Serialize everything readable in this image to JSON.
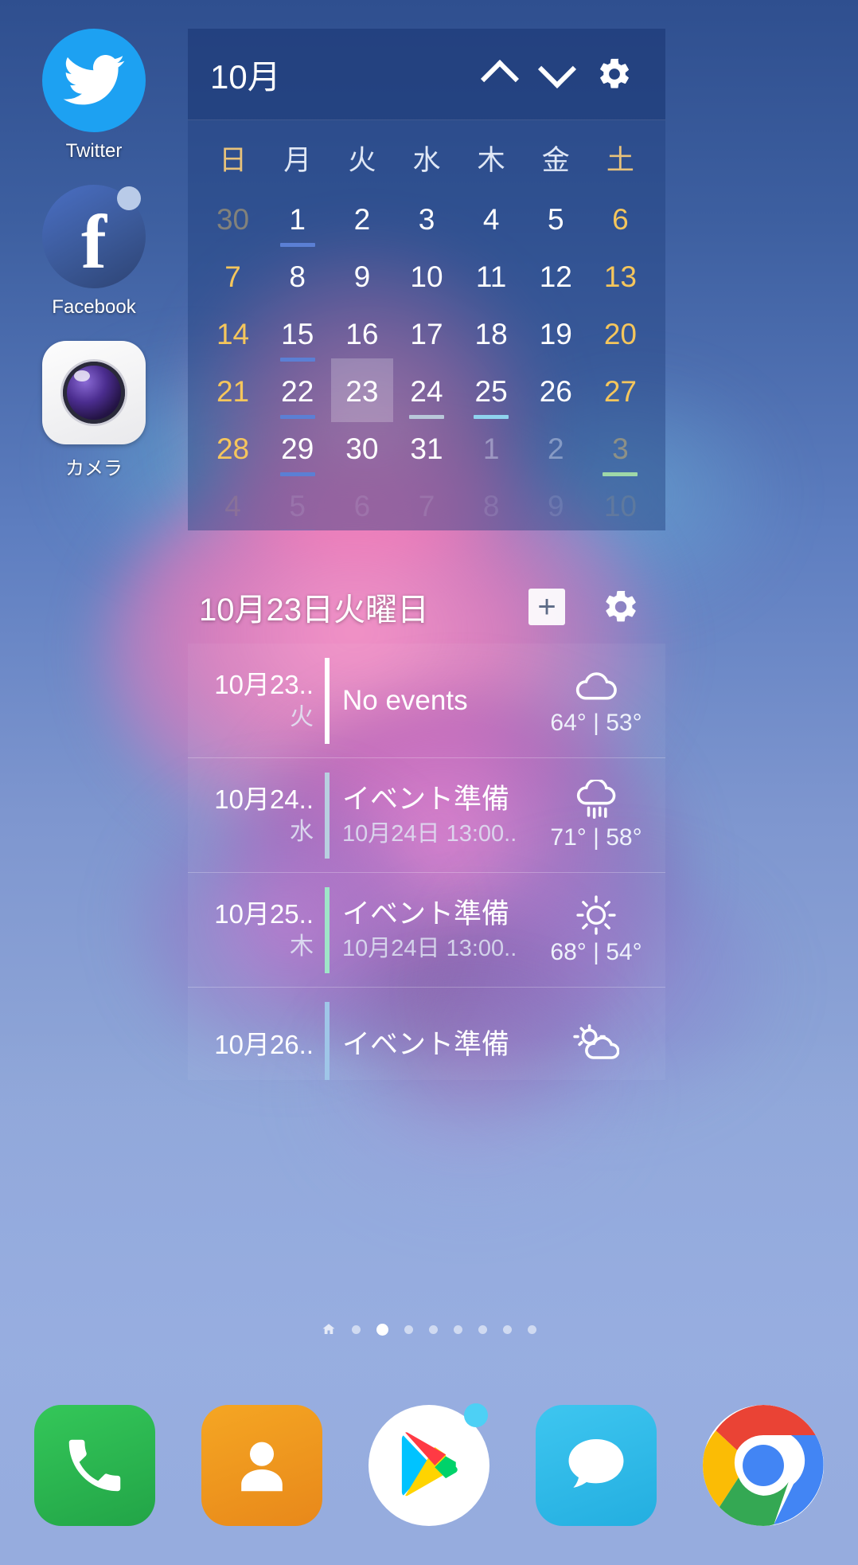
{
  "apps": [
    {
      "label": "Twitter",
      "icon": "twitter-icon",
      "badge": false
    },
    {
      "label": "Facebook",
      "icon": "facebook-icon",
      "badge": true
    },
    {
      "label": "カメラ",
      "icon": "camera-icon",
      "badge": false
    }
  ],
  "calendar_widget": {
    "month_label": "10月",
    "prev_icon": "chevron-up-icon",
    "next_icon": "chevron-down-icon",
    "settings_icon": "gear-icon",
    "weekday_headers": [
      "日",
      "月",
      "火",
      "水",
      "木",
      "金",
      "土"
    ],
    "weeks": [
      [
        {
          "n": "30",
          "other": true,
          "event": null
        },
        {
          "n": "1",
          "other": false,
          "event": "#5b7fd4"
        },
        {
          "n": "2",
          "other": false,
          "event": null
        },
        {
          "n": "3",
          "other": false,
          "event": null
        },
        {
          "n": "4",
          "other": false,
          "event": null
        },
        {
          "n": "5",
          "other": false,
          "event": null
        },
        {
          "n": "6",
          "other": false,
          "event": null
        }
      ],
      [
        {
          "n": "7",
          "other": false,
          "event": null
        },
        {
          "n": "8",
          "other": false,
          "event": null
        },
        {
          "n": "9",
          "other": false,
          "event": null
        },
        {
          "n": "10",
          "other": false,
          "event": null
        },
        {
          "n": "11",
          "other": false,
          "event": null
        },
        {
          "n": "12",
          "other": false,
          "event": null
        },
        {
          "n": "13",
          "other": false,
          "event": null
        }
      ],
      [
        {
          "n": "14",
          "other": false,
          "event": null
        },
        {
          "n": "15",
          "other": false,
          "event": "#5b7fd4"
        },
        {
          "n": "16",
          "other": false,
          "event": null
        },
        {
          "n": "17",
          "other": false,
          "event": null
        },
        {
          "n": "18",
          "other": false,
          "event": null
        },
        {
          "n": "19",
          "other": false,
          "event": null
        },
        {
          "n": "20",
          "other": false,
          "event": null
        }
      ],
      [
        {
          "n": "21",
          "other": false,
          "event": null
        },
        {
          "n": "22",
          "other": false,
          "event": "#5b7fd4"
        },
        {
          "n": "23",
          "other": false,
          "event": null,
          "today": true
        },
        {
          "n": "24",
          "other": false,
          "event": "#b9c8da"
        },
        {
          "n": "25",
          "other": false,
          "event": "#8fd3ee"
        },
        {
          "n": "26",
          "other": false,
          "event": null
        },
        {
          "n": "27",
          "other": false,
          "event": null
        }
      ],
      [
        {
          "n": "28",
          "other": false,
          "event": null
        },
        {
          "n": "29",
          "other": false,
          "event": "#5b7fd4"
        },
        {
          "n": "30",
          "other": false,
          "event": null
        },
        {
          "n": "31",
          "other": false,
          "event": null
        },
        {
          "n": "1",
          "other": true,
          "event": null
        },
        {
          "n": "2",
          "other": true,
          "event": null
        },
        {
          "n": "3",
          "other": true,
          "event": "#9fd8a8"
        }
      ],
      [
        {
          "n": "4",
          "other": true,
          "faded": true,
          "event": null
        },
        {
          "n": "5",
          "other": true,
          "faded": true,
          "event": "#5b7fd4"
        },
        {
          "n": "6",
          "other": true,
          "faded": true,
          "event": null
        },
        {
          "n": "7",
          "other": true,
          "faded": true,
          "event": null
        },
        {
          "n": "8",
          "other": true,
          "faded": true,
          "event": null
        },
        {
          "n": "9",
          "other": true,
          "faded": true,
          "event": null
        },
        {
          "n": "10",
          "other": true,
          "faded": true,
          "event": null
        }
      ]
    ]
  },
  "agenda_widget": {
    "title": "10月23日火曜日",
    "add_icon": "plus-icon",
    "add_label": "+",
    "settings_icon": "gear-icon",
    "events": [
      {
        "date_line1": "10月23..",
        "date_line2": "火",
        "title": "No events",
        "subtitle": "",
        "accent": "#ffffff",
        "weather_icon": "cloud-icon",
        "temps": "64° | 53°"
      },
      {
        "date_line1": "10月24..",
        "date_line2": "水",
        "title": "イベント準備",
        "subtitle": "10月24日 13:00..",
        "accent": "#b8cfe0",
        "weather_icon": "rain-icon",
        "temps": "71° | 58°"
      },
      {
        "date_line1": "10月25..",
        "date_line2": "木",
        "title": "イベント準備",
        "subtitle": "10月24日 13:00..",
        "accent": "#9fe5c8",
        "weather_icon": "sun-icon",
        "temps": "68° | 54°"
      },
      {
        "date_line1": "10月26..",
        "date_line2": "",
        "title": "イベント準備",
        "subtitle": "",
        "accent": "#9fc6e8",
        "weather_icon": "partly-cloudy-icon",
        "temps": ""
      }
    ]
  },
  "page_indicator": {
    "count": 9,
    "active_index": 2,
    "home_index": 0
  },
  "dock": [
    {
      "label": "Phone",
      "icon": "phone-icon",
      "badge": false
    },
    {
      "label": "Contacts",
      "icon": "contacts-icon",
      "badge": false
    },
    {
      "label": "Play Store",
      "icon": "play-store-icon",
      "badge": true
    },
    {
      "label": "Messages",
      "icon": "messages-icon",
      "badge": false
    },
    {
      "label": "Chrome",
      "icon": "chrome-icon",
      "badge": false
    }
  ],
  "colors": {
    "weekend": "#f5c65c",
    "widget_bg": "#1e3e7c",
    "accent_blue": "#5b7fd4"
  }
}
